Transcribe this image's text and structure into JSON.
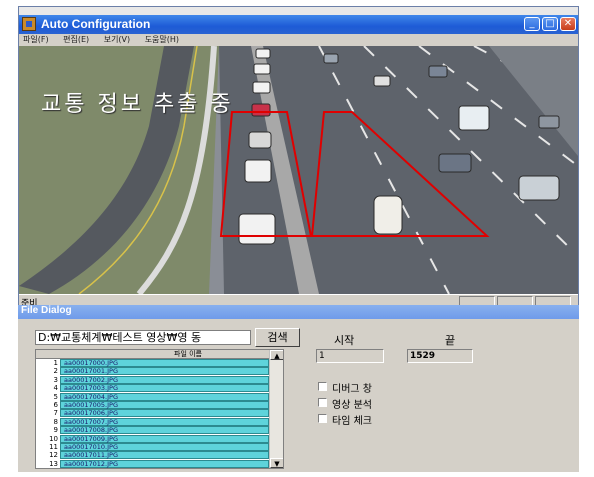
{
  "window": {
    "title": "Auto Configuration",
    "controls": {
      "minimize": "_",
      "maximize": "□",
      "close": "✕"
    }
  },
  "menu": [
    "파일(F)",
    "편집(E)",
    "보기(V)",
    "도움말(H)"
  ],
  "video": {
    "overlay_text": "교통 정보 추출 중"
  },
  "statusbar": {
    "text": "준비"
  },
  "file_dialog": {
    "title": "File Dialog",
    "path": "D:₩교통체계₩테스트 영상₩영 동",
    "search_button": "검색",
    "start_label": "시작",
    "end_label": "끝",
    "start_value": "1",
    "end_value": "1529",
    "options": [
      "디버그 창",
      "영상 분석",
      "타임 체크"
    ],
    "table": {
      "header": "파일 이름",
      "rows": [
        {
          "num": "1",
          "name": "aa00017000.JPG"
        },
        {
          "num": "2",
          "name": "aa00017001.JPG"
        },
        {
          "num": "3",
          "name": "aa00017002.JPG"
        },
        {
          "num": "4",
          "name": "aa00017003.JPG"
        },
        {
          "num": "5",
          "name": "aa00017004.JPG"
        },
        {
          "num": "6",
          "name": "aa00017005.JPG"
        },
        {
          "num": "7",
          "name": "aa00017006.JPG"
        },
        {
          "num": "8",
          "name": "aa00017007.JPG"
        },
        {
          "num": "9",
          "name": "aa00017008.JPG"
        },
        {
          "num": "10",
          "name": "aa00017009.JPG"
        },
        {
          "num": "11",
          "name": "aa00017010.JPG"
        },
        {
          "num": "12",
          "name": "aa00017011.JPG"
        },
        {
          "num": "13",
          "name": "aa00017012.JPG"
        }
      ]
    }
  },
  "colors": {
    "titlebar": "#2a63d2",
    "detection_box": "#e00000",
    "row_highlight": "#5ed3db"
  }
}
